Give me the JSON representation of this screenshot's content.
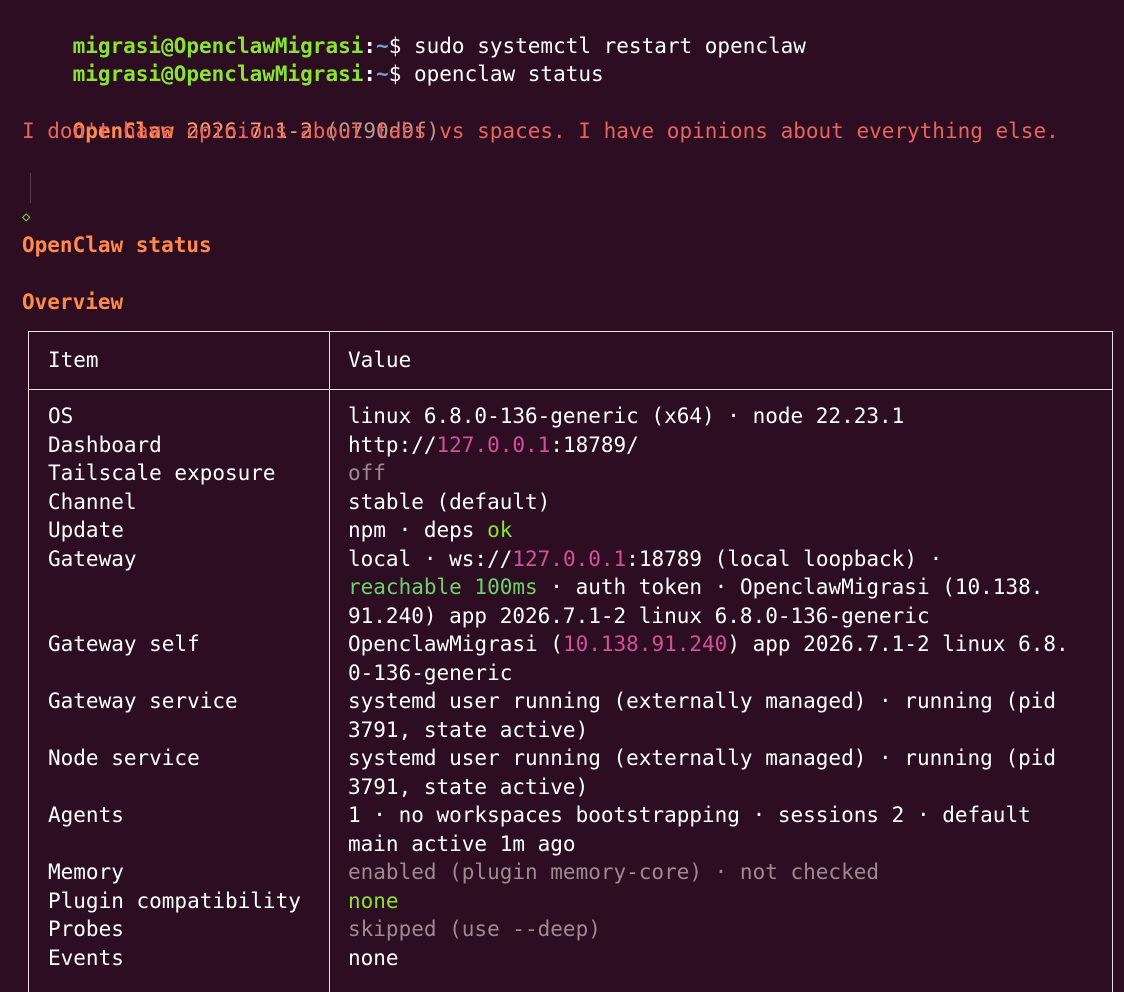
{
  "prompt": {
    "user_host": "migrasi@OpenclawMigrasi",
    "colon": ":",
    "path": "~",
    "dollar": "$"
  },
  "commands": [
    "sudo systemctl restart openclaw",
    "openclaw status"
  ],
  "banner": {
    "brand": "OpenClaw",
    "version": "2026.7.1-2",
    "hash": "(0790d9f)",
    "tagline": "I don't have opinions about tabs vs spaces. I have opinions about everything else."
  },
  "status_title": "OpenClaw status",
  "section_title": "Overview",
  "diamond_glyph": "◇",
  "table": {
    "headers": {
      "item": "Item",
      "value": "Value"
    },
    "rows": [
      {
        "key": "OS",
        "lines": [
          [
            {
              "t": "linux 6.8.0-136-generic (x64) · node 22.23.1"
            }
          ]
        ]
      },
      {
        "key": "Dashboard",
        "lines": [
          [
            {
              "t": "http://"
            },
            {
              "t": "127.0.0.1",
              "c": "ip"
            },
            {
              "t": ":18789/"
            }
          ]
        ]
      },
      {
        "key": "Tailscale exposure",
        "lines": [
          [
            {
              "t": "off",
              "c": "muted"
            }
          ]
        ]
      },
      {
        "key": "Channel",
        "lines": [
          [
            {
              "t": "stable (default)"
            }
          ]
        ]
      },
      {
        "key": "Update",
        "lines": [
          [
            {
              "t": "npm · deps "
            },
            {
              "t": "ok",
              "c": "ok"
            }
          ]
        ]
      },
      {
        "key": "Gateway",
        "lines": [
          [
            {
              "t": "local · ws://"
            },
            {
              "t": "127.0.0.1",
              "c": "ip"
            },
            {
              "t": ":18789 (local loopback) ·"
            }
          ],
          [
            {
              "t": "reachable 100ms",
              "c": "reach"
            },
            {
              "t": " · auth token · OpenclawMigrasi (10.138."
            }
          ],
          [
            {
              "t": "91.240) app 2026.7.1-2 linux 6.8.0-136-generic"
            }
          ]
        ]
      },
      {
        "key": "Gateway self",
        "lines": [
          [
            {
              "t": "OpenclawMigrasi ("
            },
            {
              "t": "10.138.91.240",
              "c": "ip"
            },
            {
              "t": ") app 2026.7.1-2 linux 6.8."
            }
          ],
          [
            {
              "t": "0-136-generic"
            }
          ]
        ]
      },
      {
        "key": "Gateway service",
        "lines": [
          [
            {
              "t": "systemd user running (externally managed) · running (pid"
            }
          ],
          [
            {
              "t": "3791, state active)"
            }
          ]
        ]
      },
      {
        "key": "Node service",
        "lines": [
          [
            {
              "t": "systemd user running (externally managed) · running (pid"
            }
          ],
          [
            {
              "t": "3791, state active)"
            }
          ]
        ]
      },
      {
        "key": "Agents",
        "lines": [
          [
            {
              "t": "1 · no workspaces bootstrapping · sessions 2 · default"
            }
          ],
          [
            {
              "t": "main active 1m ago"
            }
          ]
        ]
      },
      {
        "key": "Memory",
        "lines": [
          [
            {
              "t": "enabled (plugin memory-core) · not checked",
              "c": "muted"
            }
          ]
        ]
      },
      {
        "key": "Plugin compatibility",
        "lines": [
          [
            {
              "t": "none",
              "c": "none-ok"
            }
          ]
        ]
      },
      {
        "key": "Probes",
        "lines": [
          [
            {
              "t": "skipped (use --deep)",
              "c": "muted"
            }
          ]
        ]
      },
      {
        "key": "Events",
        "lines": [
          [
            {
              "t": "none"
            }
          ]
        ]
      }
    ]
  },
  "colors": {
    "background": "#2c0d22",
    "prompt_user": "#8ae234",
    "prompt_path": "#729fcf",
    "brand": "#ff8a4c",
    "tagline": "#e8635c",
    "ip": "#d4509c",
    "muted": "#a08890",
    "ok": "#8ae234"
  }
}
